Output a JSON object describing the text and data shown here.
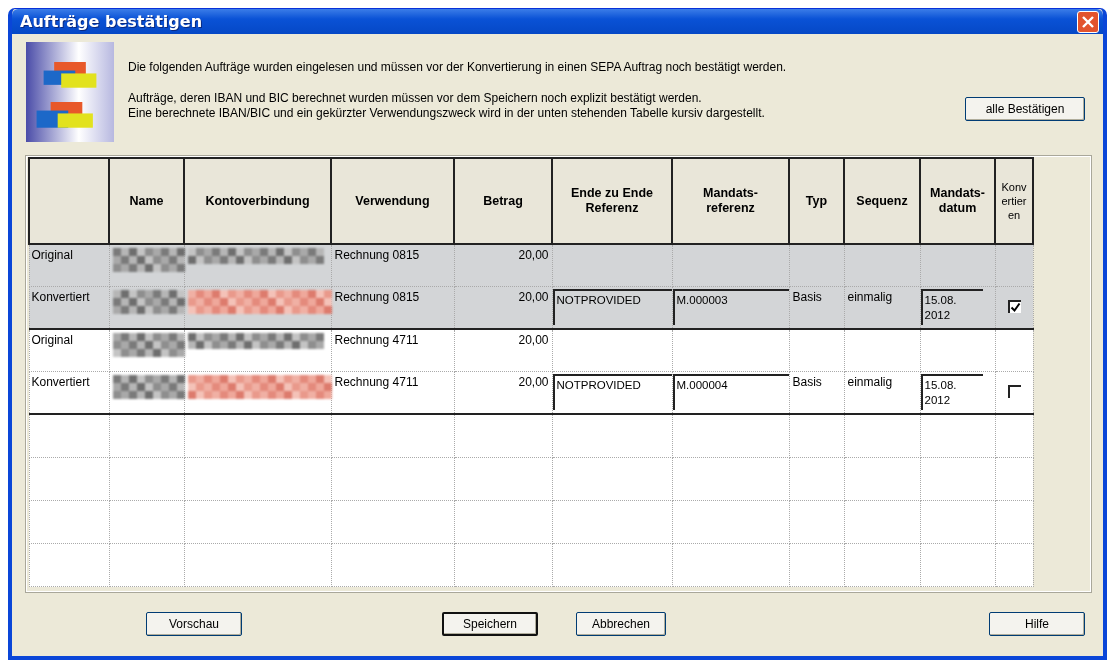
{
  "window": {
    "title": "Aufträge bestätigen"
  },
  "intro": [
    "Die folgenden Aufträge wurden eingelesen und müssen vor der Konvertierung in einen SEPA Auftrag noch bestätigt werden.",
    "Aufträge, deren IBAN und BIC berechnet wurden müssen vor dem Speichern noch explizit bestätigt werden.",
    "Eine berechnete IBAN/BIC und ein gekürzter Verwendungszweck wird in der unten stehenden Tabelle kursiv dargestellt."
  ],
  "confirm_all_button": "alle Bestätigen",
  "table": {
    "columns": [
      "",
      "Name",
      "Kontoverbindung",
      "Verwendung",
      "Betrag",
      "Ende zu Ende Referenz",
      "Mandats-referenz",
      "Typ",
      "Sequenz",
      "Mandats-datum",
      "Konvertieren"
    ],
    "groups": [
      {
        "selected": true,
        "original": {
          "label": "Original",
          "purpose": "Rechnung 0815",
          "amount": "20,00"
        },
        "converted": {
          "label": "Konvertiert",
          "purpose": "Rechnung 0815",
          "amount": "20,00",
          "e2e_reference": "NOTPROVIDED",
          "mandate_reference": "M.000003",
          "type": "Basis",
          "sequence": "einmalig",
          "mandate_date": "15.08. 2012",
          "checked": true
        }
      },
      {
        "selected": false,
        "original": {
          "label": "Original",
          "purpose": "Rechnung 4711",
          "amount": "20,00"
        },
        "converted": {
          "label": "Konvertiert",
          "purpose": "Rechnung 4711",
          "amount": "20,00",
          "e2e_reference": "NOTPROVIDED",
          "mandate_reference": "M.000004",
          "type": "Basis",
          "sequence": "einmalig",
          "mandate_date": "15.08. 2012",
          "checked": false
        }
      }
    ]
  },
  "buttons": [
    {
      "label": "Vorschau",
      "default": false
    },
    {
      "label": "Speichern",
      "default": true
    },
    {
      "label": "Abbrechen",
      "default": false
    },
    {
      "label": "Hilfe",
      "default": false
    }
  ]
}
